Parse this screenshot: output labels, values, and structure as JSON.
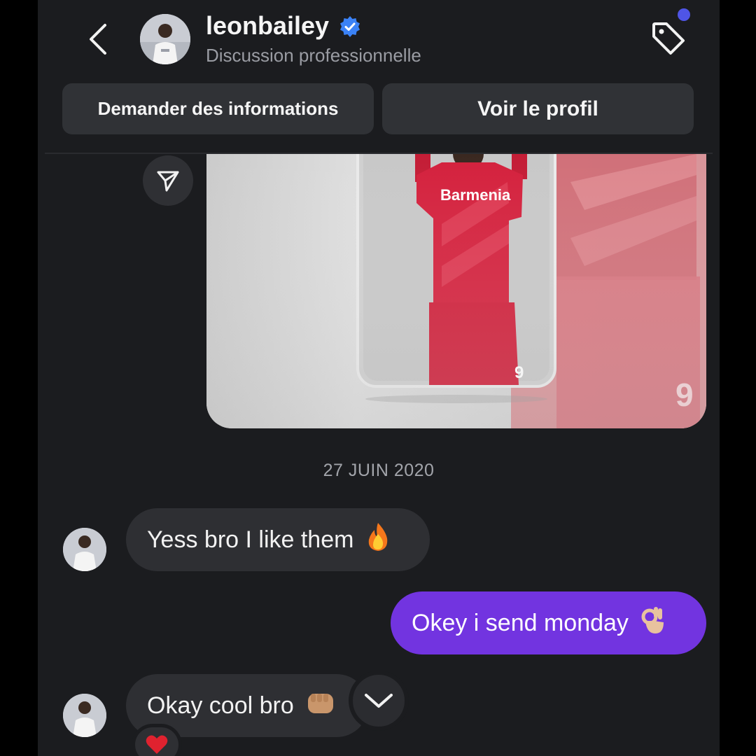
{
  "header": {
    "back_icon": "chevron-left-icon",
    "username": "leonbailey",
    "verified_icon": "verified-badge-icon",
    "subtitle": "Discussion professionnelle",
    "tag_icon": "tag-icon",
    "notification_dot_color": "#4f55e6"
  },
  "actions": {
    "request_info_label": "Demander des informations",
    "view_profile_label": "Voir le profil"
  },
  "shared_media": {
    "share_icon": "send-icon",
    "jersey_text": "Barmenia",
    "jersey_number": "9"
  },
  "thread": {
    "date": "27 JUIN 2020",
    "messages": [
      {
        "sender": "leonbailey",
        "text": "Yess bro I like them",
        "emoji": "fire-emoji"
      },
      {
        "sender": "me",
        "text": "Okey i send monday",
        "emoji": "ok-hand-emoji"
      },
      {
        "sender": "leonbailey",
        "text": "Okay cool bro",
        "emoji": "fist-bump-emoji",
        "reaction": "heart-emoji"
      }
    ]
  },
  "colors": {
    "background": "#1b1c1f",
    "incoming_bubble": "#2e2f33",
    "outgoing_bubble": "#7234e0",
    "verified": "#3b82f6",
    "jersey_red": "#d4213d"
  }
}
